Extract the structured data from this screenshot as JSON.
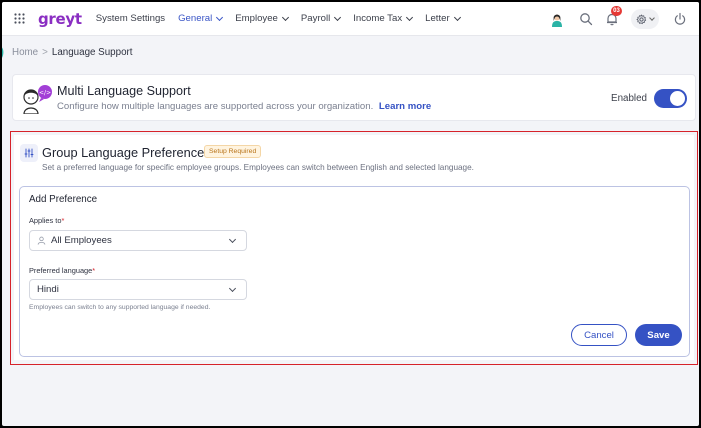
{
  "colors": {
    "accent": "#3552c4",
    "brand": "#8a2ec2",
    "highlight": "#d6222a",
    "badge": "#e53935"
  },
  "topnav": {
    "logo": "greyt",
    "items": [
      {
        "label": "System Settings",
        "dropdown": false,
        "active": false
      },
      {
        "label": "General",
        "dropdown": true,
        "active": true
      },
      {
        "label": "Employee",
        "dropdown": true,
        "active": false
      },
      {
        "label": "Payroll",
        "dropdown": true,
        "active": false
      },
      {
        "label": "Income Tax",
        "dropdown": true,
        "active": false
      },
      {
        "label": "Letter",
        "dropdown": true,
        "active": false
      }
    ],
    "notification_count": "03",
    "icons": [
      "apps-grid-icon",
      "search-icon",
      "bell-icon",
      "gear-icon",
      "power-icon"
    ]
  },
  "breadcrumb": {
    "home": "Home",
    "separator": ">",
    "current": "Language Support"
  },
  "multi_language": {
    "title": "Multi Language Support",
    "subtitle": "Configure how multiple languages are supported across your organization.",
    "link": "Learn more",
    "status_label": "Enabled",
    "enabled": true
  },
  "group_prefs": {
    "title": "Group Language Preferences",
    "badge": "Setup Required",
    "subtitle": "Set a preferred language for specific employee groups. Employees can switch between English and selected language.",
    "form": {
      "title": "Add Preference",
      "applies_to_label": "Applies to",
      "applies_to_value": "All Employees",
      "language_label": "Preferred language",
      "language_value": "Hindi",
      "hint": "Employees can switch to any supported language if needed.",
      "required_mark": "*",
      "cancel": "Cancel",
      "save": "Save"
    }
  }
}
